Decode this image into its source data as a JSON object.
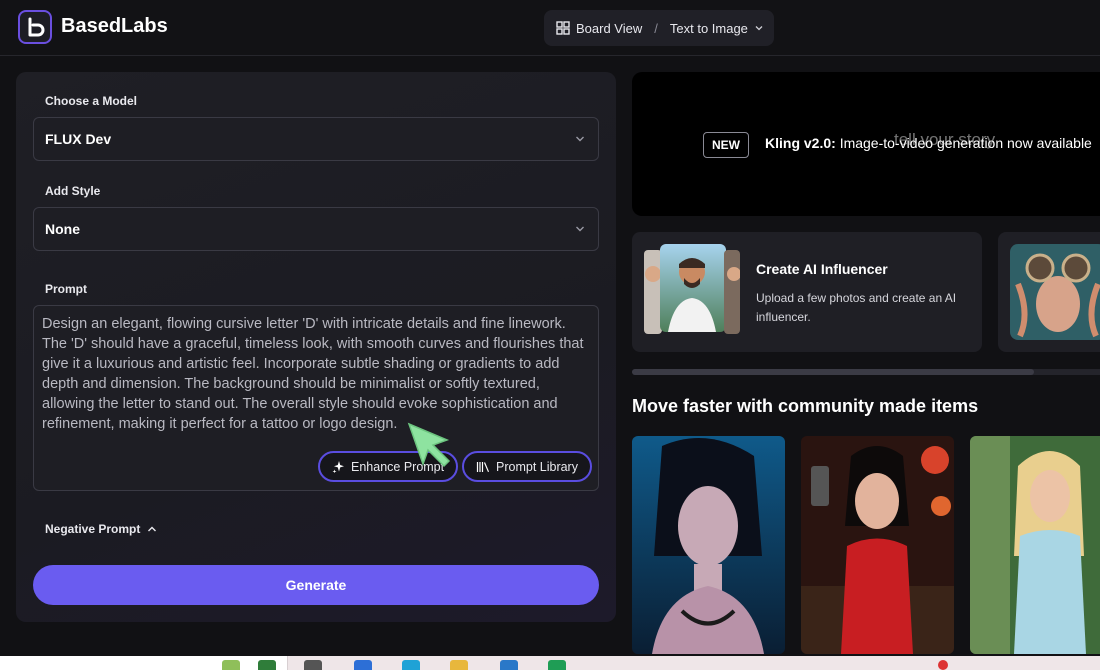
{
  "header": {
    "brand": "BasedLabs",
    "view_label": "Board View",
    "mode_label": "Text to Image"
  },
  "form": {
    "model_label": "Choose a Model",
    "model_value": "FLUX Dev",
    "style_label": "Add Style",
    "style_value": "None",
    "prompt_label": "Prompt",
    "prompt_value": "Design an elegant, flowing cursive letter 'D' with intricate details and fine linework. The 'D' should have a graceful, timeless look, with smooth curves and flourishes that give it a luxurious and artistic feel. Incorporate subtle shading or gradients to add depth and dimension. The background should be minimalist or softly textured, allowing the letter to stand out. The overall style should evoke sophistication and refinement, making it perfect for a tattoo or logo design.",
    "enhance_label": "Enhance Prompt",
    "library_label": "Prompt Library",
    "negative_label": "Negative Prompt",
    "generate_label": "Generate"
  },
  "banner": {
    "badge": "NEW",
    "headline": "Kling v2.0:",
    "text": "Image-to-video generation now available",
    "ghost_text": "tell your story"
  },
  "cards": [
    {
      "title": "Create AI Influencer",
      "desc": "Upload a few photos and create an AI influencer."
    }
  ],
  "community": {
    "title": "Move faster with community made items"
  },
  "colors": {
    "accent": "#6a5cf0",
    "pill_border": "#5a4de0",
    "cursor": "#8ee3a0"
  }
}
